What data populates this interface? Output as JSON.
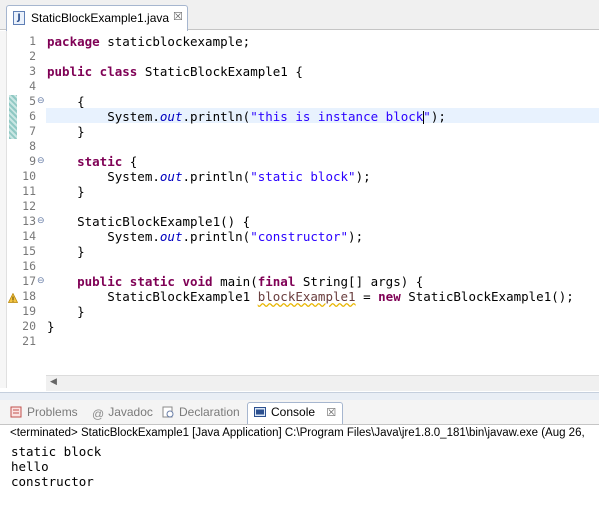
{
  "editor_tab": {
    "label": "StaticBlockExample1.java",
    "close": "☒"
  },
  "code_lines": [
    {
      "n": "1",
      "fold": "",
      "html": "<span class=\"kw\">package</span> staticblockexample;"
    },
    {
      "n": "2",
      "fold": "",
      "html": ""
    },
    {
      "n": "3",
      "fold": "",
      "html": "<span class=\"kw\">public class</span> StaticBlockExample1 {"
    },
    {
      "n": "4",
      "fold": "",
      "html": ""
    },
    {
      "n": "5",
      "fold": "⊖",
      "html": "    {"
    },
    {
      "n": "6",
      "fold": "",
      "html": "        System.<span class=\"fld\">out</span>.println(<span class=\"str\">\"this is instance block<span class=\"caret\"></span>\"</span>);"
    },
    {
      "n": "7",
      "fold": "",
      "html": "    }"
    },
    {
      "n": "8",
      "fold": "",
      "html": ""
    },
    {
      "n": "9",
      "fold": "⊖",
      "html": "    <span class=\"kw\">static</span> {"
    },
    {
      "n": "10",
      "fold": "",
      "html": "        System.<span class=\"fld\">out</span>.println(<span class=\"str\">\"static block\"</span>);"
    },
    {
      "n": "11",
      "fold": "",
      "html": "    }"
    },
    {
      "n": "12",
      "fold": "",
      "html": ""
    },
    {
      "n": "13",
      "fold": "⊖",
      "html": "    StaticBlockExample1() {"
    },
    {
      "n": "14",
      "fold": "",
      "html": "        System.<span class=\"fld\">out</span>.println(<span class=\"str\">\"constructor\"</span>);"
    },
    {
      "n": "15",
      "fold": "",
      "html": "    }"
    },
    {
      "n": "16",
      "fold": "",
      "html": ""
    },
    {
      "n": "17",
      "fold": "⊖",
      "html": "    <span class=\"kw\">public static void</span> main(<span class=\"kw\">final</span> String[] args) {"
    },
    {
      "n": "18",
      "fold": "",
      "html": "        StaticBlockExample1 <span class=\"warn-var\">blockExample1</span> = <span class=\"kw\">new</span> StaticBlockExample1();"
    },
    {
      "n": "19",
      "fold": "",
      "html": "    }"
    },
    {
      "n": "20",
      "fold": "",
      "html": "}"
    },
    {
      "n": "21",
      "fold": "",
      "html": ""
    }
  ],
  "panel_tabs": {
    "problems": "Problems",
    "javadoc": "Javadoc",
    "declaration": "Declaration",
    "console": "Console",
    "console_close": "☒"
  },
  "console": {
    "header": "<terminated> StaticBlockExample1 [Java Application] C:\\Program Files\\Java\\jre1.8.0_181\\bin\\javaw.exe (Aug 26,",
    "output": [
      "static block",
      "hello",
      "constructor"
    ]
  },
  "colors": {
    "keyword": "#7f0055",
    "string": "#2a00ff",
    "field": "#0000c0"
  }
}
